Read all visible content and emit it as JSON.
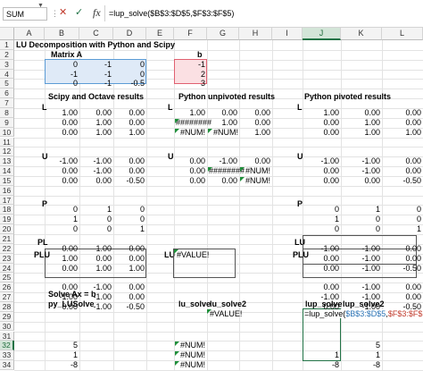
{
  "formula_bar": {
    "name_box": "SUM",
    "cancel_icon": "✕",
    "enter_icon": "✓",
    "fx_label": "fx",
    "formula": "=lup_solve($B$3:$D$5,$F$3:$F$5)"
  },
  "columns": [
    "A",
    "B",
    "C",
    "D",
    "E",
    "F",
    "G",
    "H",
    "I",
    "J",
    "K",
    "L"
  ],
  "rows": [
    "1",
    "2",
    "3",
    "4",
    "5",
    "6",
    "7",
    "8",
    "9",
    "10",
    "11",
    "12",
    "13",
    "14",
    "15",
    "16",
    "17",
    "18",
    "19",
    "20",
    "21",
    "22",
    "23",
    "24",
    "25",
    "26",
    "27",
    "28",
    "29",
    "30",
    "31",
    "32",
    "33",
    "34"
  ],
  "sheet": {
    "a1": "LU Decomposition with Python and Scipy",
    "matrix_a_label": "Matrix A",
    "b_label": "b",
    "matrix_a": [
      [
        "0",
        "-1",
        "0"
      ],
      [
        "-1",
        "-1",
        "0"
      ],
      [
        "0",
        "-1",
        "-0.5"
      ]
    ],
    "b": [
      "-1",
      "2",
      "3"
    ],
    "scipy_title": "Scipy and Octave results",
    "unpivoted_title": "Python unpivoted results",
    "pivoted_title": "Python pivoted results",
    "L": "L",
    "U": "U",
    "P": "P",
    "PL": "PL",
    "LU": "LU",
    "PLU": "PLU",
    "scipy_L": [
      [
        "1.00",
        "0.00",
        "0.00"
      ],
      [
        "0.00",
        "1.00",
        "0.00"
      ],
      [
        "0.00",
        "1.00",
        "1.00"
      ]
    ],
    "unpiv_L": [
      [
        "1.00",
        "0.00",
        "0.00"
      ],
      [
        "########",
        "1.00",
        "0.00"
      ],
      [
        "#NUM!",
        "#NUM!",
        "1.00"
      ]
    ],
    "piv_L": [
      [
        "1.00",
        "0.00",
        "0.00"
      ],
      [
        "0.00",
        "1.00",
        "0.00"
      ],
      [
        "0.00",
        "1.00",
        "1.00"
      ]
    ],
    "scipy_U": [
      [
        "-1.00",
        "-1.00",
        "0.00"
      ],
      [
        "0.00",
        "-1.00",
        "0.00"
      ],
      [
        "0.00",
        "0.00",
        "-0.50"
      ]
    ],
    "unpiv_U": [
      [
        "0.00",
        "-1.00",
        "0.00"
      ],
      [
        "0.00",
        "########",
        "#NUM!"
      ],
      [
        "0.00",
        "0.00",
        "#NUM!"
      ]
    ],
    "piv_U": [
      [
        "-1.00",
        "-1.00",
        "0.00"
      ],
      [
        "0.00",
        "-1.00",
        "0.00"
      ],
      [
        "0.00",
        "0.00",
        "-0.50"
      ]
    ],
    "scipy_P": [
      [
        "0",
        "1",
        "0"
      ],
      [
        "1",
        "0",
        "0"
      ],
      [
        "0",
        "0",
        "1"
      ]
    ],
    "piv_P": [
      [
        "0",
        "1",
        "0"
      ],
      [
        "1",
        "0",
        "0"
      ],
      [
        "0",
        "0",
        "1"
      ]
    ],
    "scipy_PL": [
      [
        "0.00",
        "1.00",
        "0.00"
      ],
      [
        "1.00",
        "0.00",
        "0.00"
      ],
      [
        "0.00",
        "1.00",
        "1.00"
      ]
    ],
    "piv_LU": [
      [
        "-1.00",
        "-1.00",
        "0.00"
      ],
      [
        "0.00",
        "-1.00",
        "0.00"
      ],
      [
        "0.00",
        "-1.00",
        "-0.50"
      ]
    ],
    "scipy_PLU": [
      [
        "0.00",
        "-1.00",
        "0.00"
      ],
      [
        "-1.00",
        "-1.00",
        "0.00"
      ],
      [
        "0.00",
        "-1.00",
        "-0.50"
      ]
    ],
    "unpiv_LU": "#VALUE!",
    "piv_PLU": [
      [
        "0.00",
        "-1.00",
        "0.00"
      ],
      [
        "-1.00",
        "-1.00",
        "0.00"
      ],
      [
        "0.00",
        "-1.00",
        "-0.50"
      ]
    ],
    "solve_title": "Solve Ax = b",
    "py_lusolve_label": "py_LUSolve",
    "py_lusolve": [
      "5",
      "1",
      "-8"
    ],
    "lu_solve_label": "lu_solve",
    "lu_solve2_label": "lu_solve2",
    "lu_solve": [
      "#NUM!",
      "#NUM!",
      "#NUM!"
    ],
    "lu_solve2": "#VALUE!",
    "lup_solve_label": "lup_solve",
    "lup_solve2_label": "lup_solve2",
    "lup_solve_edit": "=lup_solve($B$3:$D$5,$F$3:$F$5)",
    "lup_solve": [
      "1",
      "-8"
    ],
    "lup_solve2": [
      "5",
      "1",
      "-8"
    ]
  }
}
